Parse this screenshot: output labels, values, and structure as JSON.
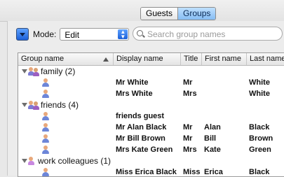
{
  "segmented": {
    "guests_label": "Guests",
    "groups_label": "Groups",
    "selected": "Groups"
  },
  "toolbar": {
    "mode_label": "Mode:",
    "mode_value": "Edit",
    "search_placeholder": "Search group names"
  },
  "table": {
    "columns": [
      "Group name",
      "Display name",
      "Title",
      "First name",
      "Last name"
    ],
    "groups": [
      {
        "label": "family (2)",
        "icon": "group-icon",
        "members": [
          {
            "display": "Mr  White",
            "title": "Mr",
            "first": "",
            "last": "White"
          },
          {
            "display": "Mrs White",
            "title": "Mrs",
            "first": "",
            "last": "White"
          }
        ]
      },
      {
        "label": "friends (4)",
        "icon": "group-icon",
        "members": [
          {
            "display": "friends guest",
            "title": "",
            "first": "",
            "last": ""
          },
          {
            "display": "Mr Alan Black",
            "title": "Mr",
            "first": "Alan",
            "last": "Black"
          },
          {
            "display": "Mr Bill Brown",
            "title": "Mr",
            "first": "Bill",
            "last": "Brown"
          },
          {
            "display": "Mrs Kate Green",
            "title": "Mrs",
            "first": "Kate",
            "last": "Green"
          }
        ]
      },
      {
        "label": "work colleagues (1)",
        "icon": "person-icon",
        "members": [
          {
            "display": "Miss Erica Black",
            "title": "Miss",
            "first": "Erica",
            "last": "Black"
          }
        ]
      }
    ]
  }
}
